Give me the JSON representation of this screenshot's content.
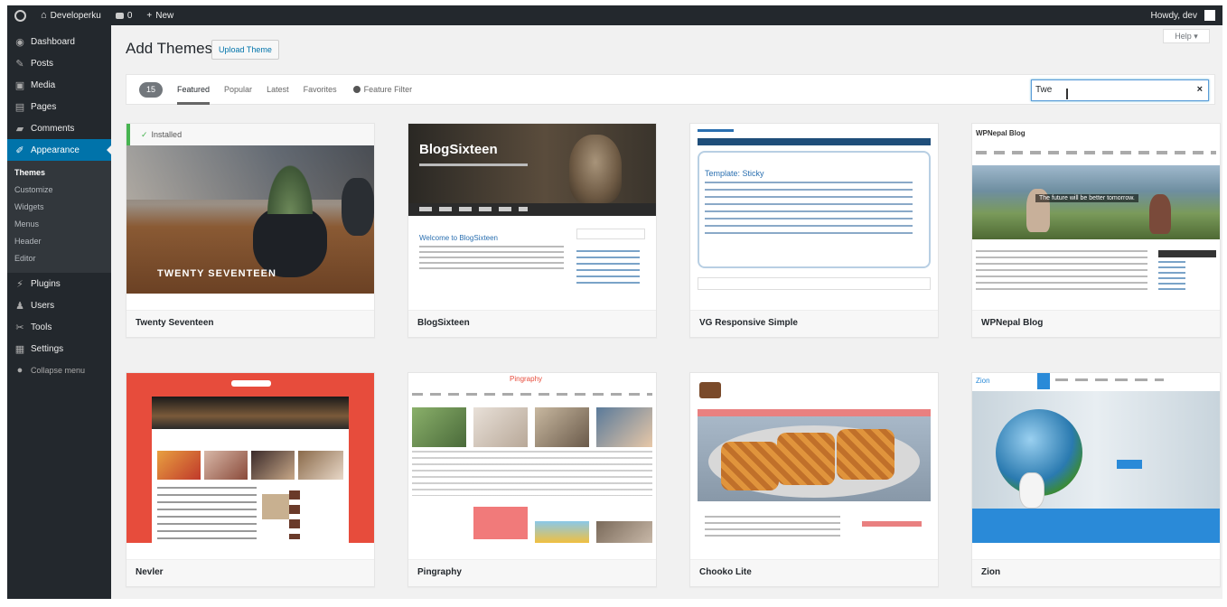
{
  "admin_bar": {
    "site_name": "Developerku",
    "comments": "0",
    "new_label": "New",
    "greeting": "Howdy, dev"
  },
  "sidebar": {
    "items": [
      {
        "label": "Dashboard",
        "icon": "dashboard-icon"
      },
      {
        "label": "Posts",
        "icon": "pin-icon"
      },
      {
        "label": "Media",
        "icon": "media-icon"
      },
      {
        "label": "Pages",
        "icon": "page-icon"
      },
      {
        "label": "Comments",
        "icon": "comment-icon"
      },
      {
        "label": "Appearance",
        "icon": "brush-icon"
      }
    ],
    "submenu": [
      "Themes",
      "Customize",
      "Widgets",
      "Menus",
      "Header",
      "Editor"
    ],
    "items_after": [
      {
        "label": "Plugins",
        "icon": "plug-icon"
      },
      {
        "label": "Users",
        "icon": "user-icon"
      },
      {
        "label": "Tools",
        "icon": "wrench-icon"
      },
      {
        "label": "Settings",
        "icon": "settings-icon"
      },
      {
        "label": "Collapse menu",
        "icon": "collapse-icon"
      }
    ]
  },
  "header": {
    "title": "Add Themes",
    "upload_label": "Upload Theme",
    "help_label": "Help ▾"
  },
  "filter": {
    "count": "15",
    "tabs": [
      "Featured",
      "Popular",
      "Latest",
      "Favorites"
    ],
    "feature_filter": "Feature Filter",
    "search_value": "Twe",
    "clear": "×"
  },
  "themes": [
    {
      "name": "Twenty Seventeen",
      "installed": "Installed",
      "banner": "TWENTY SEVENTEEN"
    },
    {
      "name": "BlogSixteen",
      "banner": "BlogSixteen",
      "post_title": "Welcome to BlogSixteen"
    },
    {
      "name": "VG Responsive Simple",
      "banner": "Template: Sticky"
    },
    {
      "name": "WPNepal Blog",
      "banner": "WPNepal Blog",
      "tagline": "The future will be better tomorrow."
    },
    {
      "name": "Nevler"
    },
    {
      "name": "Pingraphy",
      "banner": "Pingraphy"
    },
    {
      "name": "Chooko Lite"
    },
    {
      "name": "Zion",
      "banner": "Zion"
    }
  ],
  "colors": {
    "admin_dark": "#23282d",
    "accent": "#0073aa",
    "installed_green": "#46b450",
    "nevler_red": "#e74c3c"
  }
}
